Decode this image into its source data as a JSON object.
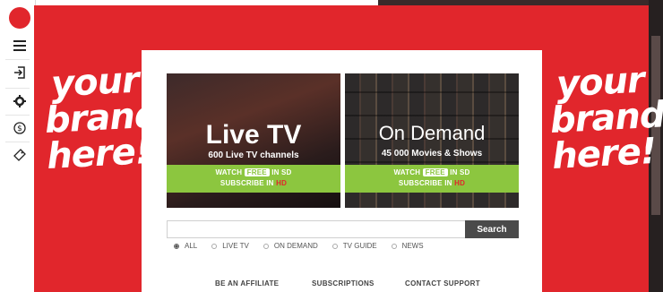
{
  "sidebar": {
    "icons": [
      "menu-icon",
      "login-icon",
      "gear-icon",
      "currency-icon",
      "tag-icon"
    ]
  },
  "brand": {
    "line1": "your",
    "line2": "brand",
    "line3": "here!"
  },
  "tiles": {
    "live": {
      "title": "Live TV",
      "subtitle": "600 Live TV channels",
      "watch_prefix": "WATCH",
      "watch_free": "FREE",
      "watch_suffix": "IN SD",
      "subscribe_prefix": "SUBSCRIBE IN",
      "subscribe_hd": "HD"
    },
    "demand": {
      "title": "On Demand",
      "subtitle": "45 000 Movies & Shows",
      "watch_prefix": "WATCH",
      "watch_free": "FREE",
      "watch_suffix": "IN SD",
      "subscribe_prefix": "SUBSCRIBE IN",
      "subscribe_hd": "HD"
    }
  },
  "search": {
    "value": "",
    "button_label": "Search"
  },
  "filters": [
    {
      "label": "ALL",
      "selected": true
    },
    {
      "label": "LIVE TV",
      "selected": false
    },
    {
      "label": "ON DEMAND",
      "selected": false
    },
    {
      "label": "TV GUIDE",
      "selected": false
    },
    {
      "label": "NEWS",
      "selected": false
    }
  ],
  "footer": {
    "affiliate": "BE AN AFFILIATE",
    "subscriptions": "SUBSCRIPTIONS",
    "support": "CONTACT SUPPORT"
  },
  "colors": {
    "brand_red": "#e1262c",
    "cta_green": "#8cc63f",
    "button_dark": "#4a4a4a"
  }
}
